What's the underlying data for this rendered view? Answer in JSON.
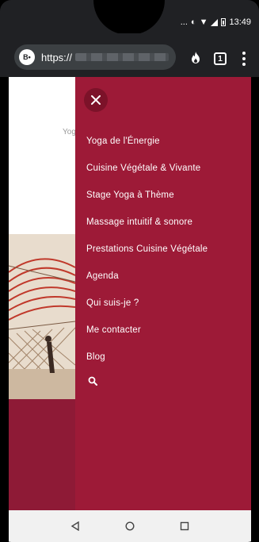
{
  "status_bar": {
    "time": "13:49",
    "ellipsis": "...",
    "battery_icon": "battery-icon",
    "signal_icon": "signal-icon",
    "wifi_icon": "wifi-icon",
    "data_saver_icon": "data-saver-icon"
  },
  "browser": {
    "url_prefix": "https://",
    "site_badge": "B•",
    "tab_count": "1"
  },
  "page": {
    "partial_text": "Yog"
  },
  "drawer": {
    "background_color": "#9d1a37",
    "menu_items": [
      {
        "label": "Yoga de l'Énergie"
      },
      {
        "label": "Cuisine Végétale & Vivante"
      },
      {
        "label": "Stage Yoga à Thème"
      },
      {
        "label": "Massage intuitif & sonore"
      },
      {
        "label": "Prestations Cuisine Végétale"
      },
      {
        "label": "Agenda"
      },
      {
        "label": "Qui suis-je ?"
      },
      {
        "label": "Me contacter"
      },
      {
        "label": "Blog"
      }
    ]
  }
}
